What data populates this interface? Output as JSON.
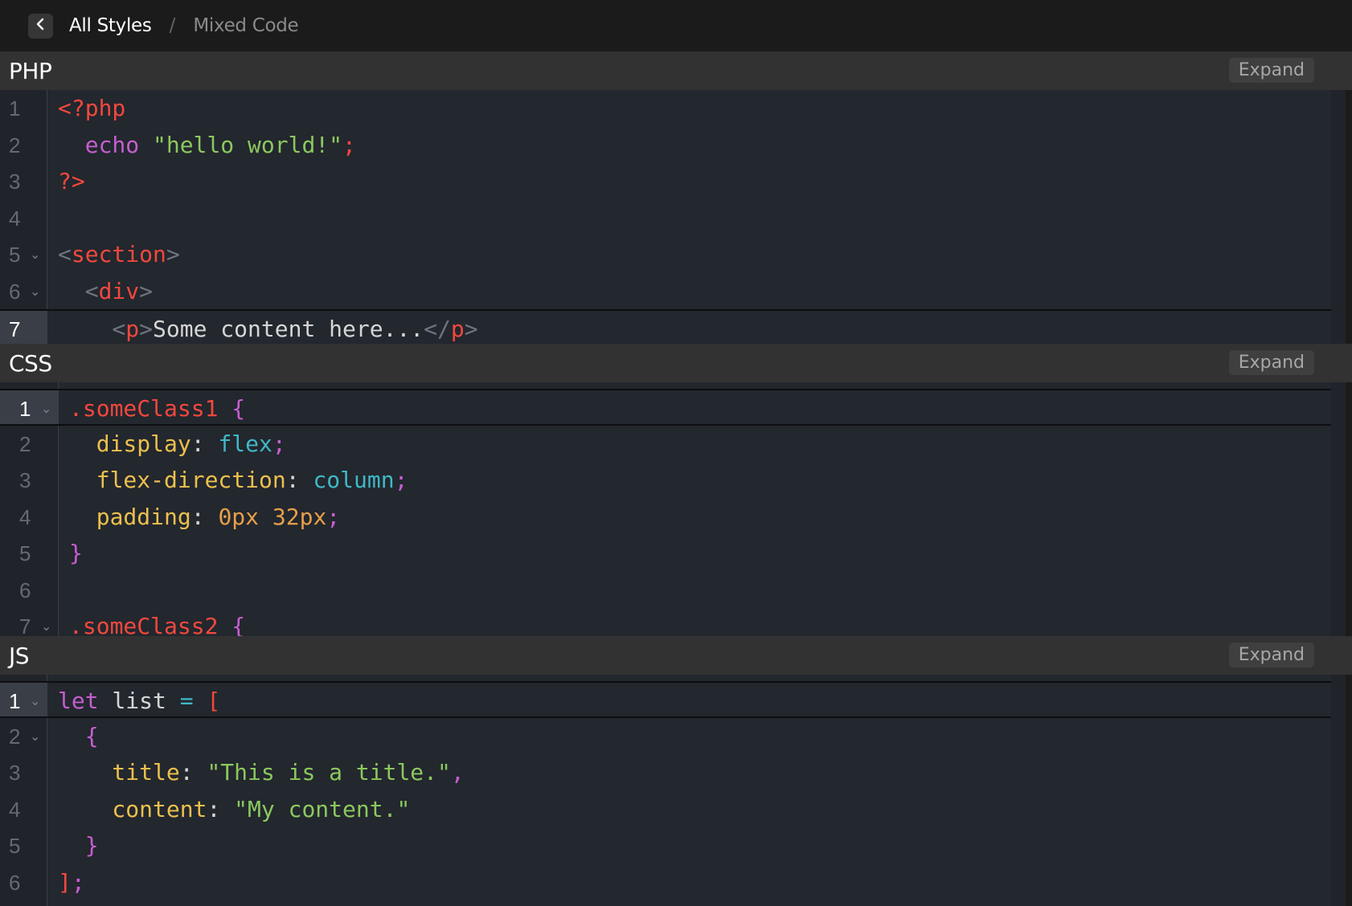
{
  "breadcrumb": {
    "current": "All Styles",
    "separator": "/",
    "previous": "Mixed Code"
  },
  "colors": {
    "tag": "#f2483e",
    "bracket": "#6f7580",
    "keyword": "#c65ed0",
    "string": "#8cc85e",
    "property": "#ecc04d",
    "value": "#3fb8c7",
    "number": "#e6a04a",
    "punct": "#c65ed0",
    "plain": "#d6d6d6"
  },
  "panels": [
    {
      "title": "PHP",
      "expand_label": "Expand",
      "lines": [
        {
          "num": "1",
          "fold": false,
          "active": false,
          "tokens": [
            {
              "t": "<?php",
              "c": "tag"
            }
          ]
        },
        {
          "num": "2",
          "fold": false,
          "active": false,
          "tokens": [
            {
              "t": "  echo ",
              "c": "keyword"
            },
            {
              "t": "\"hello world!\"",
              "c": "string"
            },
            {
              "t": ";",
              "c": "tag"
            }
          ]
        },
        {
          "num": "3",
          "fold": false,
          "active": false,
          "tokens": [
            {
              "t": "?>",
              "c": "tag"
            }
          ]
        },
        {
          "num": "4",
          "fold": false,
          "active": false,
          "tokens": []
        },
        {
          "num": "5",
          "fold": true,
          "active": false,
          "tokens": [
            {
              "t": "<",
              "c": "bracket"
            },
            {
              "t": "section",
              "c": "tag"
            },
            {
              "t": ">",
              "c": "bracket"
            }
          ]
        },
        {
          "num": "6",
          "fold": true,
          "active": false,
          "tokens": [
            {
              "t": "  <",
              "c": "bracket"
            },
            {
              "t": "div",
              "c": "tag"
            },
            {
              "t": ">",
              "c": "bracket"
            }
          ]
        },
        {
          "num": "7",
          "fold": false,
          "active": true,
          "tokens": [
            {
              "t": "    <",
              "c": "bracket"
            },
            {
              "t": "p",
              "c": "tag"
            },
            {
              "t": ">",
              "c": "bracket"
            },
            {
              "t": "Some content here...",
              "c": "plain"
            },
            {
              "t": "</",
              "c": "bracket"
            },
            {
              "t": "p",
              "c": "tag"
            },
            {
              "t": ">",
              "c": "bracket"
            }
          ]
        }
      ]
    },
    {
      "title": "CSS",
      "expand_label": "Expand",
      "lines": [
        {
          "num": "1",
          "fold": true,
          "active": true,
          "tokens": [
            {
              "t": ".someClass1 ",
              "c": "tag"
            },
            {
              "t": "{",
              "c": "keyword"
            }
          ]
        },
        {
          "num": "2",
          "fold": false,
          "active": false,
          "tokens": [
            {
              "t": "  display",
              "c": "property"
            },
            {
              "t": ": ",
              "c": "plain"
            },
            {
              "t": "flex",
              "c": "value"
            },
            {
              "t": ";",
              "c": "keyword"
            }
          ]
        },
        {
          "num": "3",
          "fold": false,
          "active": false,
          "tokens": [
            {
              "t": "  flex-direction",
              "c": "property"
            },
            {
              "t": ": ",
              "c": "plain"
            },
            {
              "t": "column",
              "c": "value"
            },
            {
              "t": ";",
              "c": "keyword"
            }
          ]
        },
        {
          "num": "4",
          "fold": false,
          "active": false,
          "tokens": [
            {
              "t": "  padding",
              "c": "property"
            },
            {
              "t": ": ",
              "c": "plain"
            },
            {
              "t": "0px 32px",
              "c": "number"
            },
            {
              "t": ";",
              "c": "keyword"
            }
          ]
        },
        {
          "num": "5",
          "fold": false,
          "active": false,
          "tokens": [
            {
              "t": "}",
              "c": "keyword"
            }
          ]
        },
        {
          "num": "6",
          "fold": false,
          "active": false,
          "tokens": []
        },
        {
          "num": "7",
          "fold": true,
          "active": false,
          "tokens": [
            {
              "t": ".someClass2 ",
              "c": "tag"
            },
            {
              "t": "{",
              "c": "keyword"
            }
          ]
        }
      ]
    },
    {
      "title": "JS",
      "expand_label": "Expand",
      "lines": [
        {
          "num": "1",
          "fold": true,
          "active": true,
          "tokens": [
            {
              "t": "let ",
              "c": "keyword"
            },
            {
              "t": "list ",
              "c": "plain"
            },
            {
              "t": "= ",
              "c": "value"
            },
            {
              "t": "[",
              "c": "tag"
            }
          ]
        },
        {
          "num": "2",
          "fold": true,
          "active": false,
          "tokens": [
            {
              "t": "  {",
              "c": "keyword"
            }
          ]
        },
        {
          "num": "3",
          "fold": false,
          "active": false,
          "tokens": [
            {
              "t": "    title",
              "c": "property"
            },
            {
              "t": ": ",
              "c": "plain"
            },
            {
              "t": "\"This is a title.\"",
              "c": "string"
            },
            {
              "t": ",",
              "c": "keyword"
            }
          ]
        },
        {
          "num": "4",
          "fold": false,
          "active": false,
          "tokens": [
            {
              "t": "    content",
              "c": "property"
            },
            {
              "t": ": ",
              "c": "plain"
            },
            {
              "t": "\"My content.\"",
              "c": "string"
            }
          ]
        },
        {
          "num": "5",
          "fold": false,
          "active": false,
          "tokens": [
            {
              "t": "  }",
              "c": "keyword"
            }
          ]
        },
        {
          "num": "6",
          "fold": false,
          "active": false,
          "tokens": [
            {
              "t": "]",
              "c": "tag"
            },
            {
              "t": ";",
              "c": "keyword"
            }
          ]
        }
      ]
    }
  ]
}
